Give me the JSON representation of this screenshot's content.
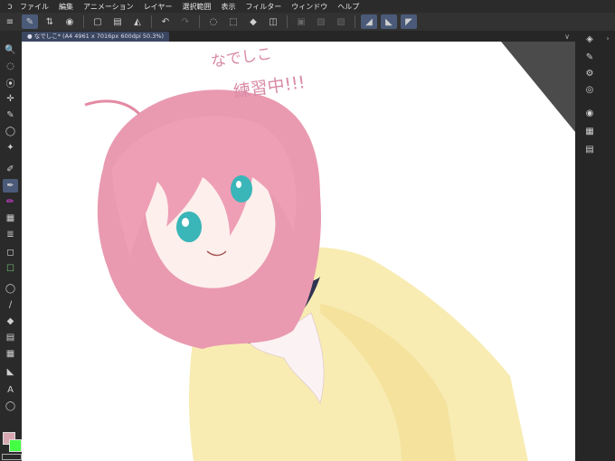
{
  "menu": {
    "logo": "ↄ",
    "items": [
      "ファイル",
      "編集",
      "アニメーション",
      "レイヤー",
      "選択範囲",
      "表示",
      "フィルター",
      "ウィンドウ",
      "ヘルプ"
    ],
    "right_icons": [
      "minimize-icon",
      "restore-icon",
      "close-icon"
    ]
  },
  "toolbar": {
    "icons": [
      "≡",
      "✎",
      "⇅",
      "◉",
      "▢",
      "▤",
      "◭",
      "↶",
      "↷",
      "◌",
      "⬚",
      "◆",
      "◫",
      "▣",
      "▧",
      "▨",
      "◢",
      "◣",
      "◤"
    ]
  },
  "document": {
    "tab_label": "● なでしこ* (A4 4961 x 7016px 600dpi 50.3%)",
    "tab_chevron": "∨"
  },
  "canvas": {
    "handwriting_line1": "なでしこ",
    "handwriting_line2": "練習中!!!",
    "background": "#ffffff",
    "hair_color": "#e99ab0",
    "eye_color": "#3ab5b8",
    "sweater_color": "#f7e9a9",
    "collar_color": "#2e3350",
    "text_color": "#d98aa6"
  },
  "left_tools": [
    "🔍",
    "◌",
    "⦿",
    "✛",
    "✎",
    "◯",
    "✦",
    "✐",
    "✒",
    "✏",
    "▦",
    "≣",
    "◻",
    "☐",
    "◯",
    "∕",
    "◆",
    "▤",
    "▦",
    "◣",
    "A",
    "◯"
  ],
  "color_swatches": {
    "main": "#d9a7b1",
    "sub": "#44ff44"
  }
}
